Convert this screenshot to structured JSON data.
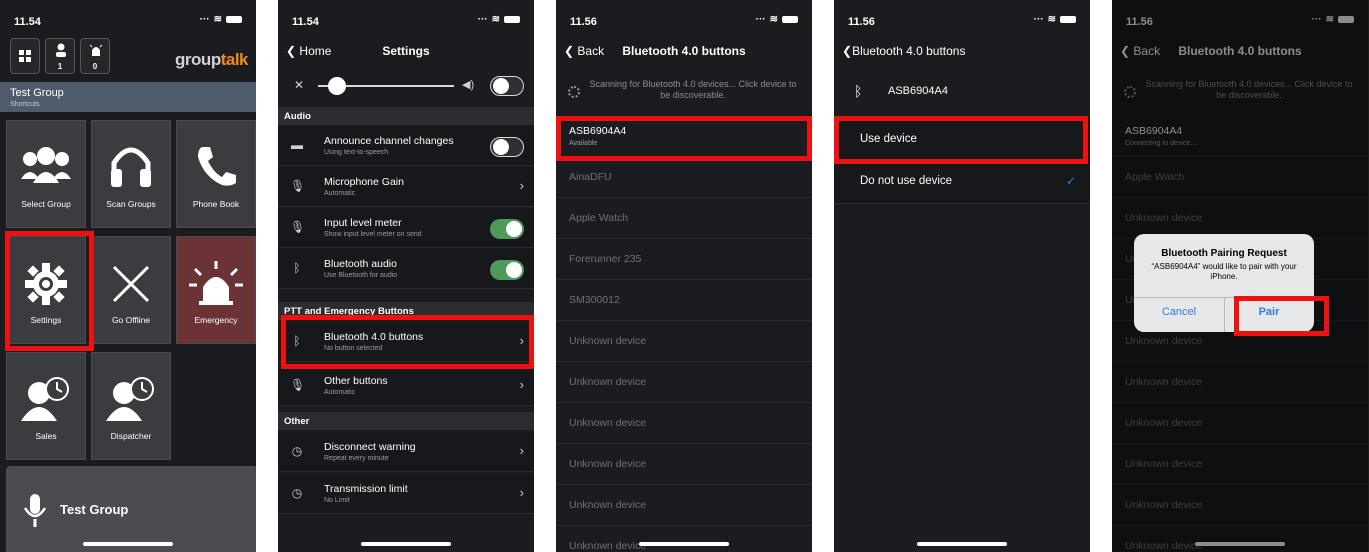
{
  "status": {
    "time1": "11.54",
    "time2": "11.54",
    "time3": "11.56",
    "time4": "11.56",
    "time5": "11.56"
  },
  "screen1": {
    "logo_main": "group",
    "logo_accent": "talk",
    "toolbar_counts": [
      "1",
      "0"
    ],
    "group_title": "Test Group",
    "group_sub": "Shortcuts",
    "tiles": [
      "Select Group",
      "Scan Groups",
      "Phone Book",
      "Settings",
      "Go Offline",
      "Emergency",
      "Sales",
      "Dispatcher"
    ],
    "ptt_label": "Test Group"
  },
  "screen2": {
    "back": "Home",
    "title": "Settings",
    "sections": [
      "Audio",
      "PTT and Emergency Buttons",
      "Other"
    ],
    "rows": [
      {
        "title": "Announce channel changes",
        "sub": "Using text-to-speech"
      },
      {
        "title": "Microphone Gain",
        "sub": "Automatic"
      },
      {
        "title": "Input level meter",
        "sub": "Show input level meter on send"
      },
      {
        "title": "Bluetooth audio",
        "sub": "Use Bluetooth for audio"
      },
      {
        "title": "Bluetooth 4.0 buttons",
        "sub": "No button selected"
      },
      {
        "title": "Other buttons",
        "sub": "Automatic"
      },
      {
        "title": "Disconnect warning",
        "sub": "Repeat every minute"
      },
      {
        "title": "Transmission limit",
        "sub": "No Limit"
      }
    ]
  },
  "screen3": {
    "back": "Back",
    "title": "Bluetooth 4.0 buttons",
    "scan": "Scanning for Bluetooth 4.0 devices... Click device to be discoverable.",
    "devices": [
      {
        "name": "ASB6904A4",
        "sub": "Available"
      },
      {
        "name": "AinaDFU"
      },
      {
        "name": "Apple Watch"
      },
      {
        "name": "Forerunner 235"
      },
      {
        "name": "SM300012"
      },
      {
        "name": "Unknown device"
      },
      {
        "name": "Unknown device"
      },
      {
        "name": "Unknown device"
      },
      {
        "name": "Unknown device"
      },
      {
        "name": "Unknown device"
      },
      {
        "name": "Unknown device"
      }
    ]
  },
  "screen4": {
    "back": "Bluetooth 4.0 buttons",
    "device": "ASB6904A4",
    "use": "Use device",
    "nouse": "Do not use device",
    "check": "✓"
  },
  "screen5": {
    "back": "Back",
    "title": "Bluetooth 4.0 buttons",
    "scan": "Scanning for Bluetooth 4.0 devices... Click device to be discoverable.",
    "devices": [
      {
        "name": "ASB6904A4",
        "sub": "Connecting to device..."
      },
      {
        "name": "Apple Watch"
      },
      {
        "name": "Unknown device"
      },
      {
        "name": "Unkn"
      },
      {
        "name": "Unkn"
      },
      {
        "name": "Unknown device"
      },
      {
        "name": "Unknown device"
      },
      {
        "name": "Unknown device"
      },
      {
        "name": "Unknown device"
      },
      {
        "name": "Unknown device"
      },
      {
        "name": "Unknown device"
      }
    ],
    "alert_title": "Bluetooth Pairing Request",
    "alert_msg": "“ASB6904A4” would like to pair with your iPhone.",
    "cancel": "Cancel",
    "pair": "Pair"
  },
  "colors": {
    "highlight": "#ee1111",
    "toggle_on": "#4d9a5a",
    "emergency": "#6b3336",
    "link": "#2f7bd9",
    "logo_accent": "#f28a1c"
  }
}
